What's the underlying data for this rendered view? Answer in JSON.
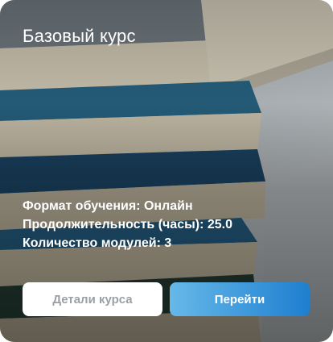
{
  "card": {
    "title": "Базовый курс",
    "details": [
      "Формат обучения: Онлайн",
      "Продолжительность (часы): 25.0",
      "Количество модулей: 3"
    ],
    "buttons": {
      "details_label": "Детали курса",
      "go_label": "Перейти"
    },
    "colors": {
      "primary_button": "#1e7fd0",
      "secondary_button_text": "#9aa0a6"
    },
    "background_image": "stack-of-books-photo"
  }
}
